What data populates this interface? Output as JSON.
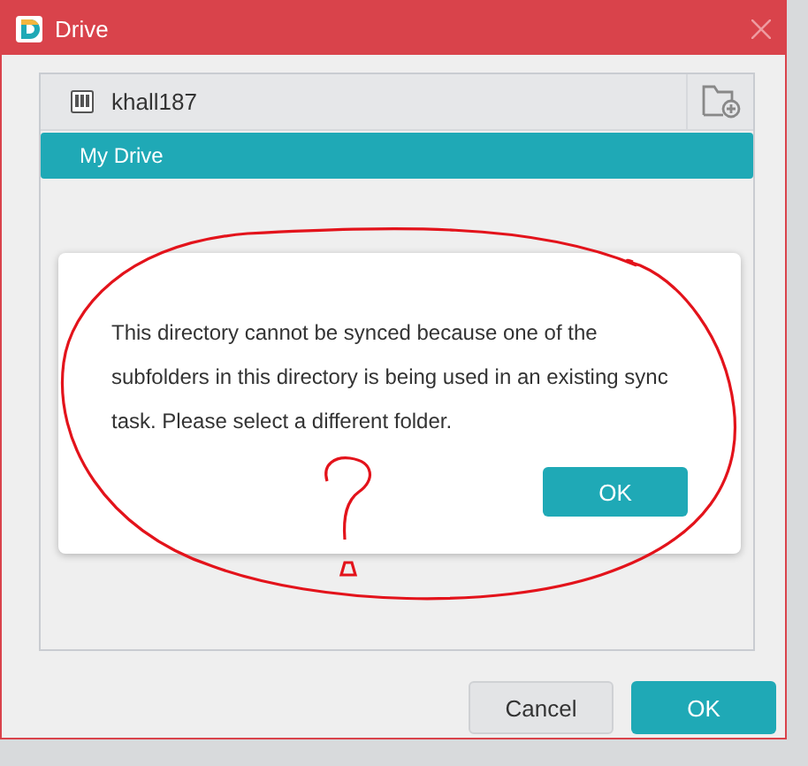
{
  "window": {
    "title": "Drive"
  },
  "panel": {
    "account": "khall187",
    "items": [
      {
        "label": "My Drive",
        "selected": true
      }
    ]
  },
  "message": {
    "text": "This directory cannot be synced because one of the subfolders in this directory is being used in an existing sync task. Please select a different folder.",
    "button": "OK"
  },
  "buttons": [
    {
      "label": "Cancel",
      "kind": "secondary"
    },
    {
      "label": "OK",
      "kind": "primary"
    }
  ]
}
